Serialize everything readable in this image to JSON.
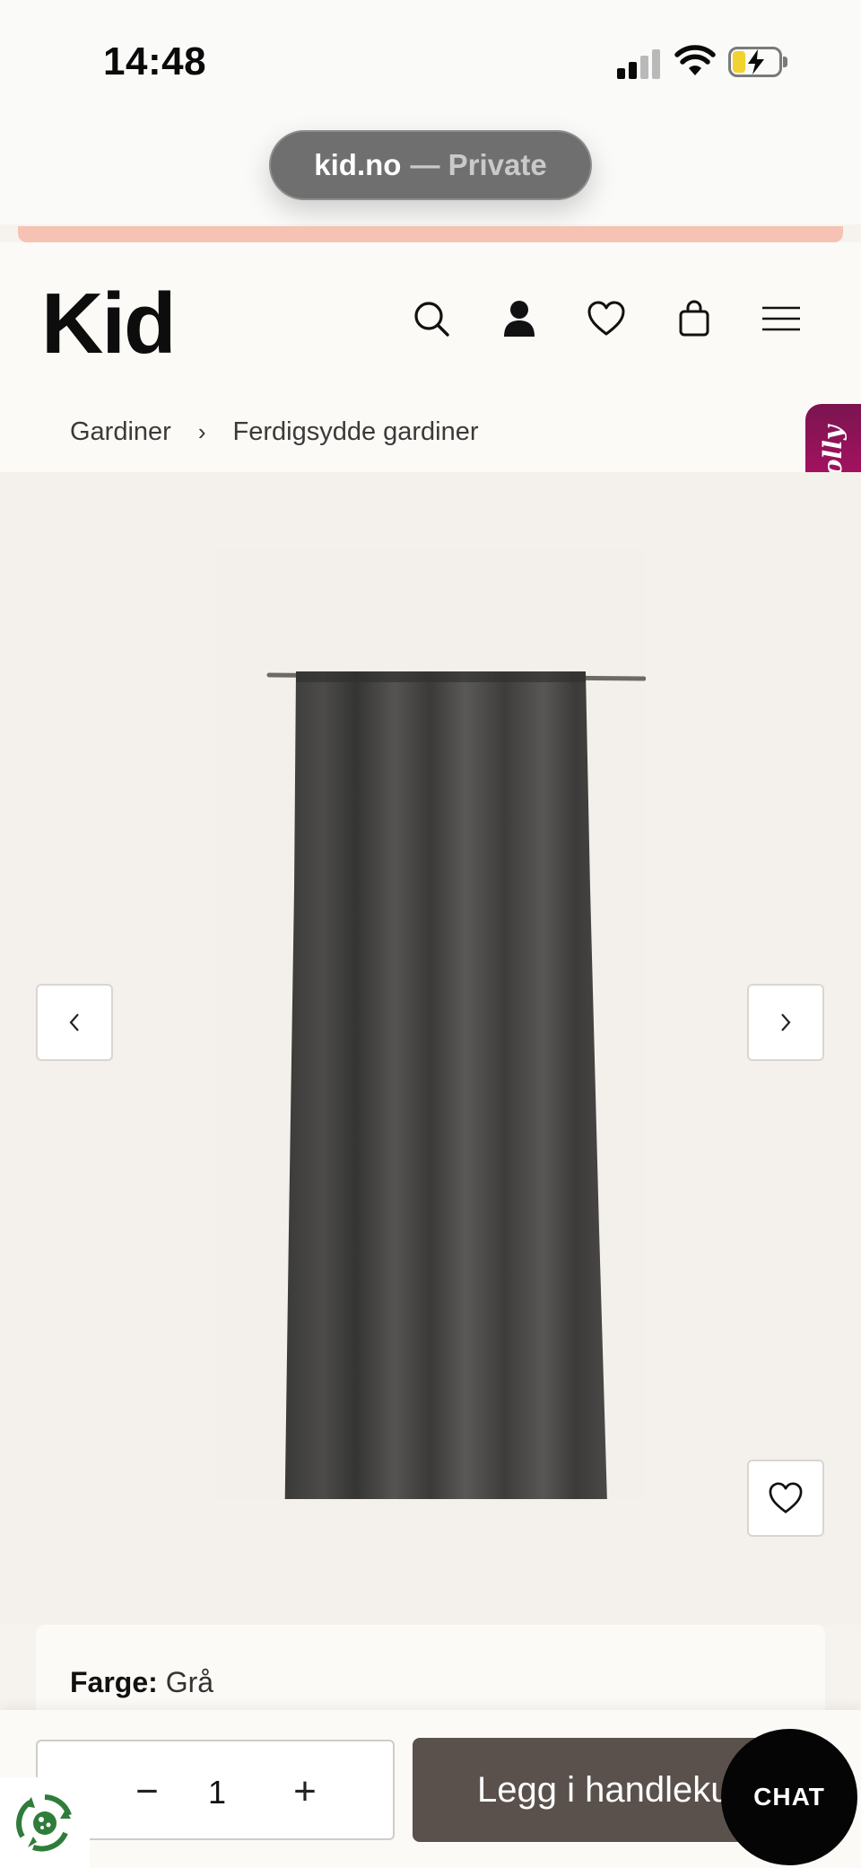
{
  "status_bar": {
    "time": "14:48"
  },
  "browser": {
    "domain": "kid.no",
    "mode": "— Private"
  },
  "header": {
    "logo": "Kid",
    "icons": [
      "search-icon",
      "account-icon",
      "wishlist-icon",
      "cart-icon",
      "menu-icon"
    ]
  },
  "breadcrumb": {
    "items": [
      "Gardiner",
      "Ferdigsydde gardiner"
    ],
    "separator": "›"
  },
  "side_tab": {
    "label": "Molly"
  },
  "product": {
    "color_label": "Farge:",
    "color_value": "Grå"
  },
  "footer": {
    "minus": "−",
    "quantity": "1",
    "plus": "+",
    "add_to_cart": "Legg i handlekurv"
  },
  "chat": {
    "label": "CHAT"
  },
  "colors": {
    "accent_promo": "#f6c2b4",
    "cart_button": "#5a514c",
    "molly_tab": "#b0125f",
    "page_bg": "#f4f1ec"
  }
}
